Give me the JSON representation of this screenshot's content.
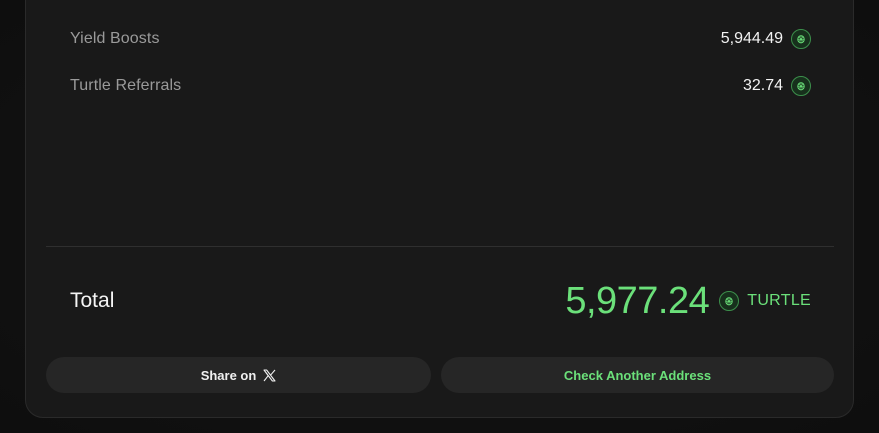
{
  "rows": [
    {
      "label": "Yield Boosts",
      "value": "5,944.49",
      "icon": "turtle-token-icon"
    },
    {
      "label": "Turtle Referrals",
      "value": "32.74",
      "icon": "turtle-token-icon"
    }
  ],
  "total": {
    "label": "Total",
    "value": "5,977.24",
    "icon": "turtle-token-icon",
    "symbol": "TURTLE"
  },
  "buttons": {
    "share_label": "Share on",
    "share_icon": "x-logo-icon",
    "check_label": "Check Another Address"
  },
  "colors": {
    "accent": "#6be07a",
    "card_background": "#191919",
    "button_background": "#262626"
  }
}
